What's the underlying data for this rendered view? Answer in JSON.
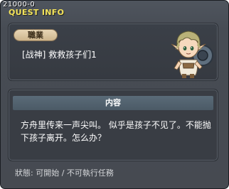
{
  "window": {
    "quest_id": "21000-0",
    "title": "QUEST INFO"
  },
  "quest": {
    "job_label": "職業",
    "name": "[战神] 救救孩子们1",
    "portrait_icon": "elf-child-npc-portrait"
  },
  "content": {
    "header": "内容",
    "description": "方舟里传来一声尖叫。 似乎是孩子不见了。不能抛下孩子离开。怎么办？"
  },
  "status": {
    "text": "狀態: 可開始 / 不可執行任務"
  },
  "colors": {
    "title": "#f4e45a",
    "window_bg": "#474c54",
    "header_bar": "#52626e",
    "badge": "#dac6a2"
  }
}
